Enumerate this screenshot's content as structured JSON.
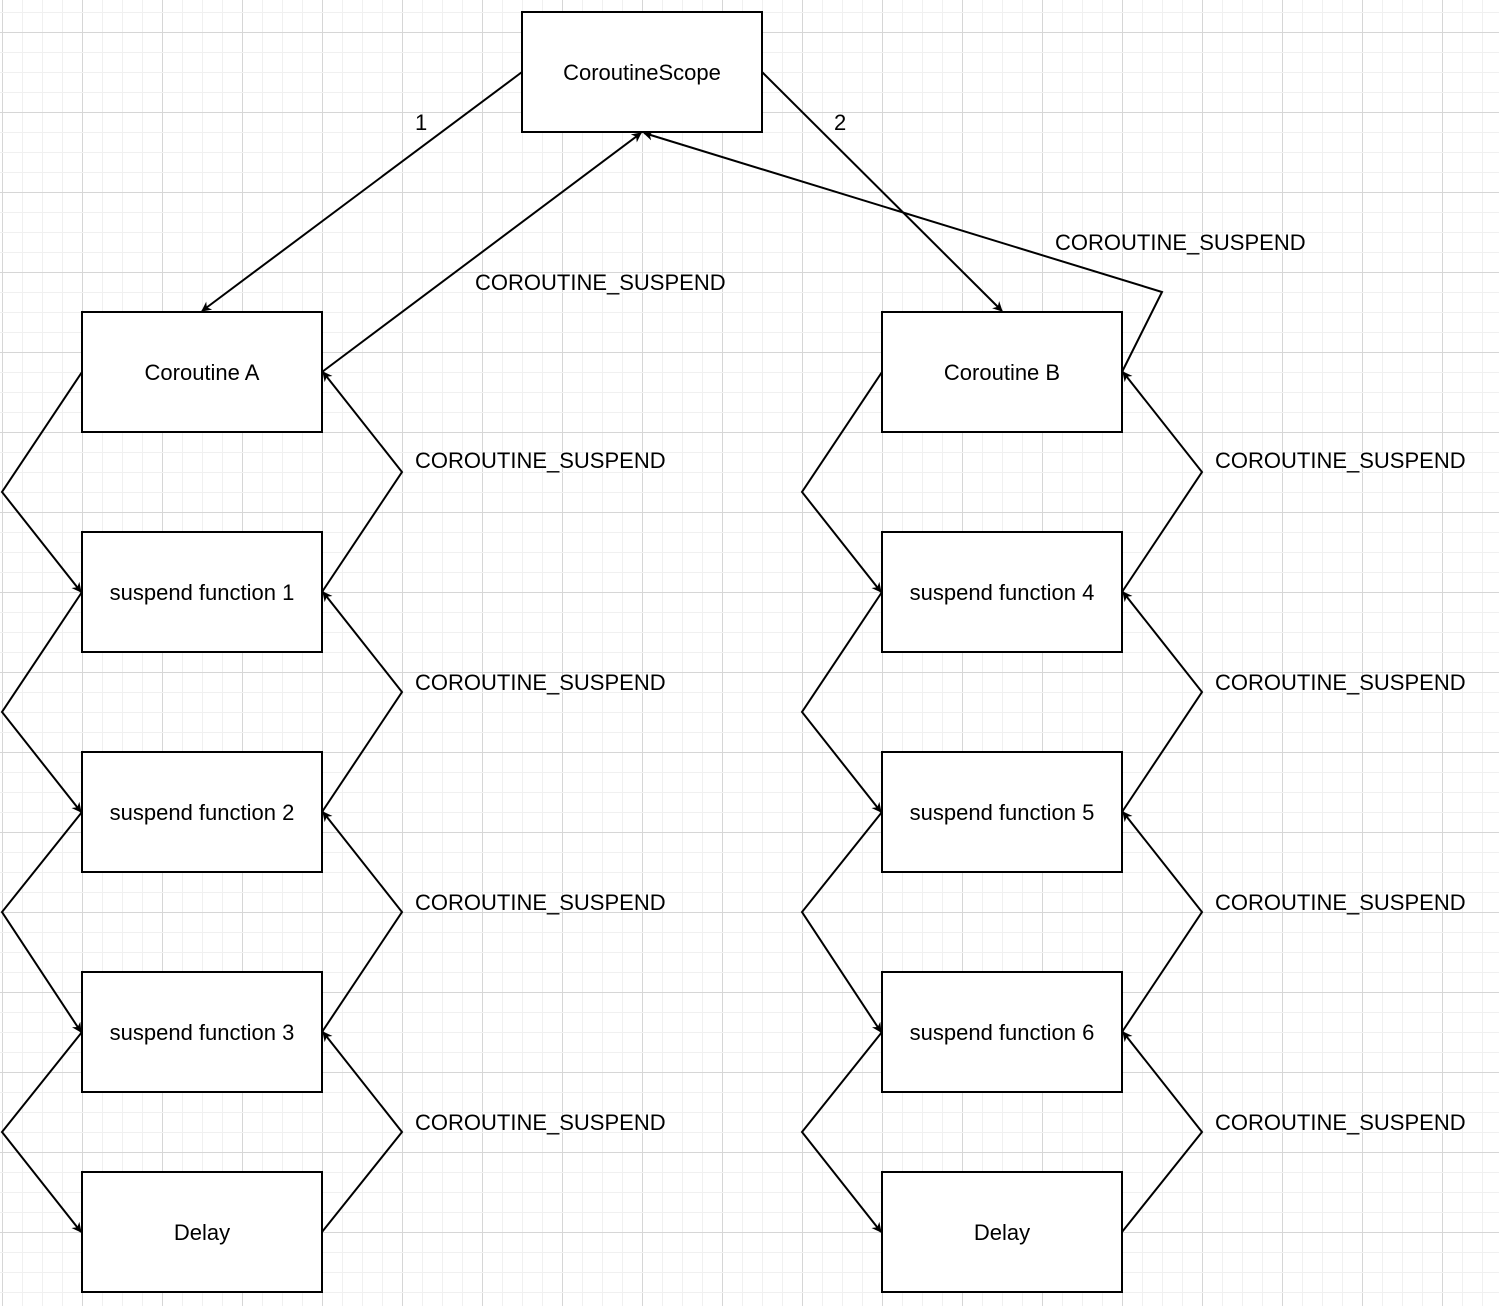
{
  "diagram": {
    "scope": {
      "label": "CoroutineScope"
    },
    "launch_edges": [
      {
        "label": "1"
      },
      {
        "label": "2"
      }
    ],
    "scope_return_labels": [
      "COROUTINE_SUSPEND",
      "COROUTINE_SUSPEND"
    ],
    "columns": [
      {
        "nodes": [
          "Coroutine A",
          "suspend function 1",
          "suspend function 2",
          "suspend function 3",
          "Delay"
        ],
        "return_labels": [
          "COROUTINE_SUSPEND",
          "COROUTINE_SUSPEND",
          "COROUTINE_SUSPEND",
          "COROUTINE_SUSPEND"
        ]
      },
      {
        "nodes": [
          "Coroutine B",
          "suspend function 4",
          "suspend function 5",
          "suspend function 6",
          "Delay"
        ],
        "return_labels": [
          "COROUTINE_SUSPEND",
          "COROUTINE_SUSPEND",
          "COROUTINE_SUSPEND",
          "COROUTINE_SUSPEND"
        ]
      }
    ],
    "colors": {
      "stroke": "#000000",
      "grid_minor": "#f0f0f0",
      "grid_major": "#d6d6d6",
      "background": "#ffffff"
    }
  }
}
